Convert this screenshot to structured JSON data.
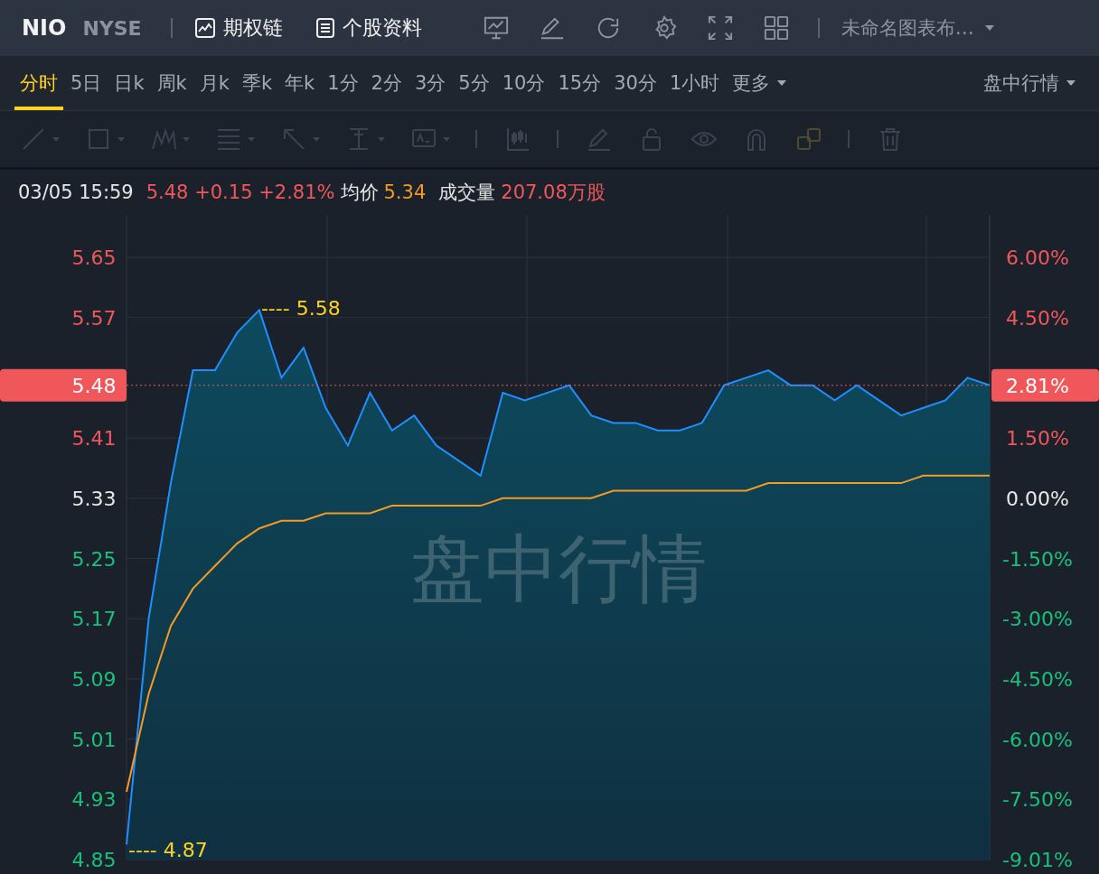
{
  "header": {
    "symbol": "NIO",
    "exchange": "NYSE",
    "links": [
      "期权链",
      "个股资料"
    ],
    "layout": "未命名图表布…"
  },
  "periods": [
    {
      "label": "分时",
      "selected": true
    },
    {
      "label": "5日",
      "selected": false
    },
    {
      "label": "日k",
      "selected": false
    },
    {
      "label": "周k",
      "selected": false
    },
    {
      "label": "月k",
      "selected": false
    },
    {
      "label": "季k",
      "selected": false
    },
    {
      "label": "年k",
      "selected": false
    },
    {
      "label": "1分",
      "selected": false
    },
    {
      "label": "2分",
      "selected": false
    },
    {
      "label": "3分",
      "selected": false
    },
    {
      "label": "5分",
      "selected": false
    },
    {
      "label": "10分",
      "selected": false
    },
    {
      "label": "15分",
      "selected": false
    },
    {
      "label": "30分",
      "selected": false
    },
    {
      "label": "1小时",
      "selected": false
    }
  ],
  "more": "更多",
  "session": "盘中行情",
  "info": [
    {
      "text": "03/05 15:59",
      "kind": "plain"
    },
    {
      "text": "5.48 +0.15 +2.81%",
      "kind": "up"
    },
    {
      "text": "均价",
      "kind": "plain"
    },
    {
      "text": "5.34",
      "kind": "avg"
    },
    {
      "text": "成交量",
      "kind": "plain"
    },
    {
      "text": "207.08万股",
      "kind": "up"
    }
  ],
  "chart": {
    "watermark": "盘中行情",
    "right_axis": [
      {
        "label": "6.00%",
        "kind": "up"
      },
      {
        "label": "4.50%",
        "kind": "up"
      },
      {
        "label": "1.50%",
        "kind": "up"
      },
      {
        "label": "0.00%",
        "kind": "flat"
      },
      {
        "label": "-1.50%",
        "kind": "down"
      },
      {
        "label": "-3.00%",
        "kind": "down"
      },
      {
        "label": "-4.50%",
        "kind": "down"
      },
      {
        "label": "-6.00%",
        "kind": "down"
      },
      {
        "label": "-7.50%",
        "kind": "down"
      },
      {
        "label": "-9.01%",
        "kind": "down"
      }
    ],
    "chart_data": {
      "type": "area",
      "ylim": [
        4.85,
        5.65
      ],
      "grid": true,
      "yticks": [
        {
          "value": 5.65,
          "label": "5.65"
        },
        {
          "value": 5.57,
          "label": "5.57"
        },
        {
          "value": 5.41,
          "label": "5.41"
        },
        {
          "value": 5.33,
          "label": "5.33"
        },
        {
          "value": 5.25,
          "label": "5.25"
        },
        {
          "value": 5.17,
          "label": "5.17"
        },
        {
          "value": 5.09,
          "label": "5.09"
        },
        {
          "value": 5.01,
          "label": "5.01"
        },
        {
          "value": 4.93,
          "label": "4.93"
        },
        {
          "value": 4.85,
          "label": "4.85"
        }
      ],
      "series": [
        {
          "type": "area",
          "color": "#1f8fff",
          "values": [
            4.87,
            5.17,
            5.35,
            5.5,
            5.5,
            5.55,
            5.58,
            5.49,
            5.53,
            5.45,
            5.4,
            5.47,
            5.42,
            5.44,
            5.4,
            5.38,
            5.36,
            5.47,
            5.46,
            5.47,
            5.48,
            5.44,
            5.43,
            5.43,
            5.42,
            5.42,
            5.43,
            5.48,
            5.49,
            5.5,
            5.48,
            5.48,
            5.46,
            5.48,
            5.46,
            5.44,
            5.45,
            5.46,
            5.49,
            5.48
          ]
        },
        {
          "type": "line",
          "color": "#f59a23",
          "values": [
            4.94,
            5.07,
            5.16,
            5.21,
            5.24,
            5.27,
            5.29,
            5.3,
            5.3,
            5.31,
            5.31,
            5.31,
            5.32,
            5.32,
            5.32,
            5.32,
            5.32,
            5.33,
            5.33,
            5.33,
            5.33,
            5.33,
            5.34,
            5.34,
            5.34,
            5.34,
            5.34,
            5.34,
            5.34,
            5.35,
            5.35,
            5.35,
            5.35,
            5.35,
            5.35,
            5.35,
            5.36,
            5.36,
            5.36,
            5.36
          ]
        }
      ],
      "ref_lines": [
        {
          "axis": "y",
          "value": 5.48,
          "label": "5.48",
          "color": "#f0575a"
        }
      ],
      "annotations": [
        "---- 5.58",
        "---- 4.87",
        "2.81%"
      ]
    }
  }
}
